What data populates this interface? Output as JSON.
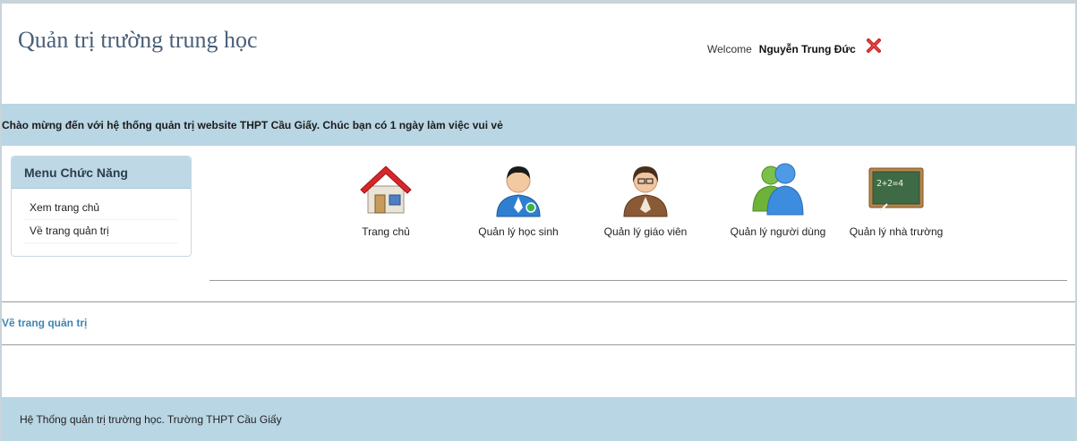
{
  "header": {
    "title": "Quản trị trường trung học",
    "welcome_label": "Welcome",
    "user_name": "Nguyễn Trung Đức",
    "logout_icon": "close-icon"
  },
  "banner": {
    "message": "Chào mừng đến với hệ thống quản trị website THPT Cầu Giấy. Chúc bạn có 1 ngày làm việc vui vẻ"
  },
  "menu": {
    "title": "Menu Chức Năng",
    "items": [
      {
        "label": "Xem trang chủ"
      },
      {
        "label": "Về trang quản trị"
      }
    ]
  },
  "tiles": [
    {
      "label": "Trang chủ",
      "icon": "home-icon"
    },
    {
      "label": "Quản lý học sinh",
      "icon": "student-icon"
    },
    {
      "label": "Quản lý giáo viên",
      "icon": "teacher-icon"
    },
    {
      "label": "Quản lý người dùng",
      "icon": "users-icon"
    },
    {
      "label": "Quản lý nhà trường",
      "icon": "chalkboard-icon"
    }
  ],
  "links": {
    "admin": "Về trang quản trị"
  },
  "footer": {
    "text": "Hệ Thống quản trị trường học. Trường THPT Cầu Giấy"
  }
}
